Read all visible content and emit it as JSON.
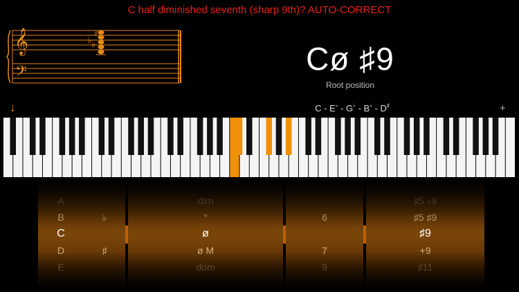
{
  "header": {
    "title": "C half diminished seventh (sharp 9th)? AUTO-CORRECT"
  },
  "chord": {
    "name": "Cø ♯9",
    "inversion": "Root position",
    "spelling": [
      {
        "note": "C",
        "acc": ""
      },
      {
        "note": "E",
        "acc": "♭"
      },
      {
        "note": "G",
        "acc": "♭"
      },
      {
        "note": "B",
        "acc": "♭"
      },
      {
        "note": "D",
        "acc": "♯"
      }
    ]
  },
  "keyboard": {
    "highlight_color": "#f0900a",
    "highlighted_white_key_indices": [
      23
    ],
    "highlighted_black_key_indices": [
      16,
      18,
      20
    ]
  },
  "picker": {
    "selected_color": "#e07008",
    "columns": [
      {
        "id": "root",
        "items": [
          "A",
          "B",
          "C",
          "D",
          "E"
        ],
        "selected": 2
      },
      {
        "id": "accidental",
        "items": [
          "♭",
          "",
          "♯"
        ],
        "selected": 1
      },
      {
        "id": "quality",
        "items": [
          "dim",
          "°",
          "ø",
          "ø M",
          "dom"
        ],
        "selected": 2
      },
      {
        "id": "extension",
        "items": [
          "6",
          "",
          "7",
          "9"
        ],
        "selected": 1
      },
      {
        "id": "alteration",
        "items": [
          "♯5 ♭9",
          "♯5 ♯9",
          "♯9",
          "+9",
          "♯11"
        ],
        "selected": 2
      }
    ]
  },
  "icons": {
    "arrow": "down-arrow-icon",
    "add": "plus-icon"
  }
}
